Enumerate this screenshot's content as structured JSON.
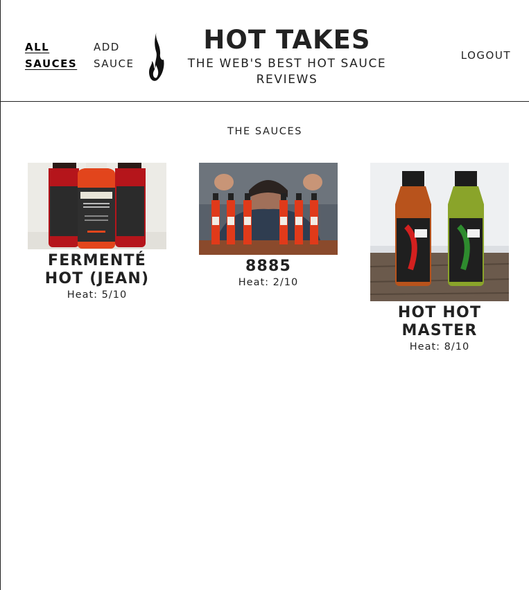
{
  "nav": {
    "all_sauces": "ALL SAUCES",
    "add_sauce": "ADD SAUCE",
    "logout": "LOGOUT"
  },
  "brand": {
    "title": "HOT TAKES",
    "tagline": "THE WEB'S BEST HOT SAUCE REVIEWS",
    "logo_icon": "flame-icon"
  },
  "section": {
    "title": "THE SAUCES"
  },
  "sauces": [
    {
      "name": "FERMENTÉ HOT (JEAN)",
      "heat": "Heat: 5/10",
      "image": "three-burn-fermented-hot-sauce-bottles"
    },
    {
      "name": "8885",
      "heat": "Heat: 2/10",
      "image": "man-behind-row-of-red-hot-sauce-bottles"
    },
    {
      "name": "HOT HOT MASTER",
      "heat": "Heat: 8/10",
      "image": "two-word-of-mouth-sauce-bottles"
    }
  ],
  "colors": {
    "text": "#222222",
    "background": "#ffffff",
    "sauce_red": "#e2451c",
    "sauce_green": "#8aa42a"
  }
}
